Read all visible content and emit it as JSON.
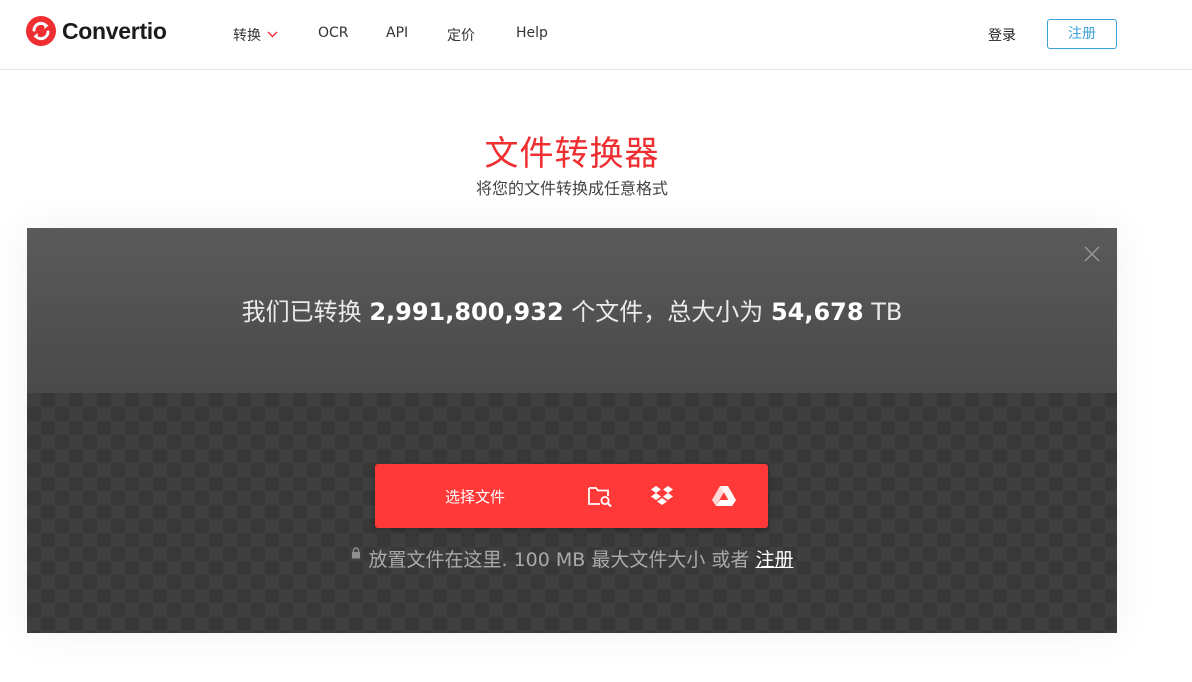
{
  "brand": {
    "name": "Convertio",
    "accent": "#ee2e31"
  },
  "nav": {
    "items": [
      {
        "label": "转换",
        "has_dropdown": true
      },
      {
        "label": "OCR"
      },
      {
        "label": "API"
      },
      {
        "label": "定价"
      },
      {
        "label": "Help"
      }
    ]
  },
  "auth": {
    "login": "登录",
    "signup": "注册"
  },
  "hero": {
    "title": "文件转换器",
    "subtitle": "将您的文件转换成任意格式"
  },
  "stats": {
    "prefix": "我们已转换",
    "files_count": "2,991,800,932",
    "middle": "个文件，总大小为",
    "total_size": "54,678",
    "unit": "TB"
  },
  "uploader": {
    "choose_label": "选择文件",
    "icons": [
      "folder-search-icon",
      "dropbox-icon",
      "google-drive-icon"
    ],
    "drop_text": "放置文件在这里. 100 MB 最大文件大小 或者",
    "register_link": "注册"
  },
  "colors": {
    "button_red": "#ff3838",
    "signup_blue": "#3aa1d8"
  }
}
